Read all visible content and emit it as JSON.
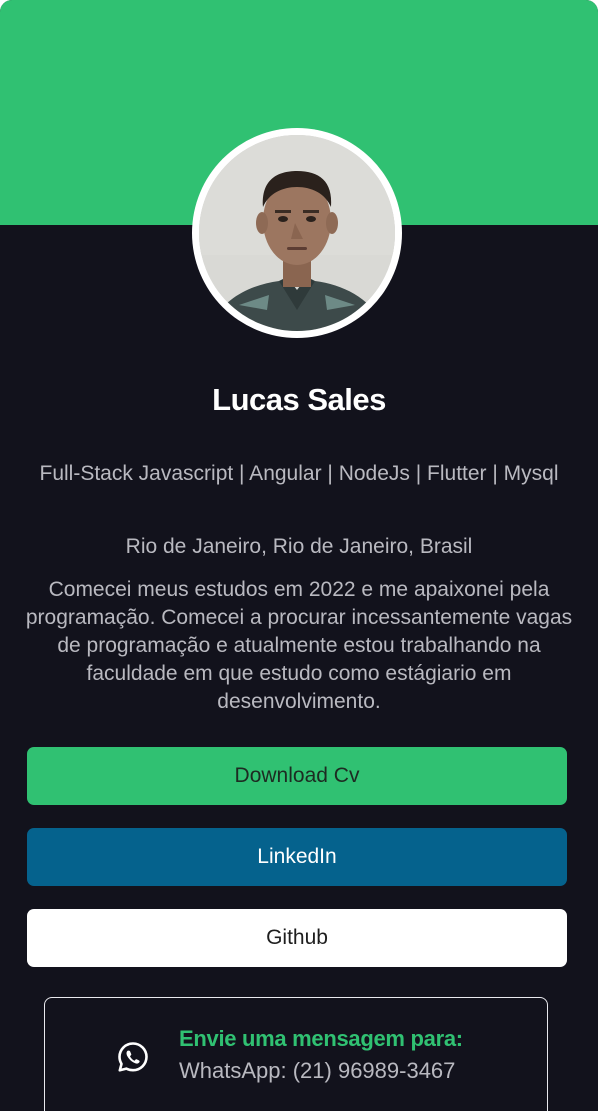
{
  "profile": {
    "name": "Lucas Sales",
    "title": "Full-Stack Javascript | Angular | NodeJs | Flutter | Mysql",
    "location": "Rio de Janeiro, Rio de Janeiro, Brasil",
    "bio": "Comecei meus estudos em 2022 e me apaixonei pela programação. Comecei a procurar incessantemente vagas de programação e atualmente estou trabalhando na faculdade em que estudo como estágiario em desenvolvimento."
  },
  "buttons": {
    "download_cv": "Download Cv",
    "linkedin": "LinkedIn",
    "github": "Github"
  },
  "whatsapp": {
    "icon": "whatsapp-icon",
    "heading": "Envie uma mensagem para:",
    "number": "WhatsApp: (21) 96989-3467"
  },
  "colors": {
    "accent_green": "#30c172",
    "background": "#12121c",
    "linkedin_blue": "#05628d",
    "text_muted": "#b9b9c0"
  }
}
